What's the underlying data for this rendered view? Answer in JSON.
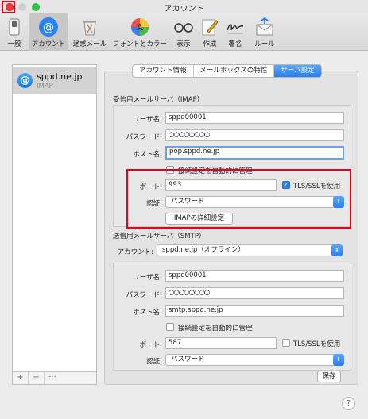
{
  "window": {
    "title": "アカウント"
  },
  "toolbar": {
    "items": [
      {
        "label": "一般",
        "icon": "switch-icon"
      },
      {
        "label": "アカウント",
        "icon": "at-icon"
      },
      {
        "label": "迷惑メール",
        "icon": "trash-icon"
      },
      {
        "label": "フォントとカラー",
        "icon": "color-wheel-icon"
      },
      {
        "label": "表示",
        "icon": "glasses-icon"
      },
      {
        "label": "作成",
        "icon": "pencil-icon"
      },
      {
        "label": "署名",
        "icon": "signature-icon"
      },
      {
        "label": "ルール",
        "icon": "rules-icon"
      }
    ],
    "selected": "アカウント"
  },
  "sidebar": {
    "accounts": [
      {
        "name": "sppd.ne.jp",
        "type": "IMAP",
        "icon": "@"
      }
    ],
    "footer": {
      "add": "+",
      "remove": "−",
      "more": "···"
    }
  },
  "tabs": [
    {
      "label": "アカウント情報",
      "active": false
    },
    {
      "label": "メールボックスの特性",
      "active": false
    },
    {
      "label": "サーバ設定",
      "active": true
    }
  ],
  "incoming": {
    "title": "受信用メールサーバ（IMAP）",
    "username_label": "ユーザ名:",
    "username": "sppd00001",
    "password_label": "パスワード:",
    "password": "○○○○○○○○",
    "host_label": "ホスト名:",
    "host": "pop.sppd.ne.jp",
    "auto_manage_label": "接続設定を自動的に管理",
    "auto_manage": false,
    "port_label": "ポート:",
    "port": "993",
    "tls_label": "TLS/SSLを使用",
    "tls": true,
    "auth_label": "認証:",
    "auth": "パスワード",
    "advanced_button": "IMAPの詳細設定"
  },
  "outgoing": {
    "title": "送信用メールサーバ（SMTP）",
    "account_label": "アカウント:",
    "account": "sppd.ne.jp（オフライン）",
    "username_label": "ユーザ名:",
    "username": "sppd00001",
    "password_label": "パスワード:",
    "password": "○○○○○○○○",
    "host_label": "ホスト名:",
    "host": "smtp.sppd.ne.jp",
    "auto_manage_label": "接続設定を自動的に管理",
    "auto_manage": false,
    "port_label": "ポート:",
    "port": "587",
    "tls_label": "TLS/SSLを使用",
    "tls": false,
    "auth_label": "認証:",
    "auth": "パスワード",
    "save_button": "保存"
  },
  "help": "?",
  "colors": {
    "accent": "#2a7ef0",
    "highlight": "#e3001b"
  }
}
